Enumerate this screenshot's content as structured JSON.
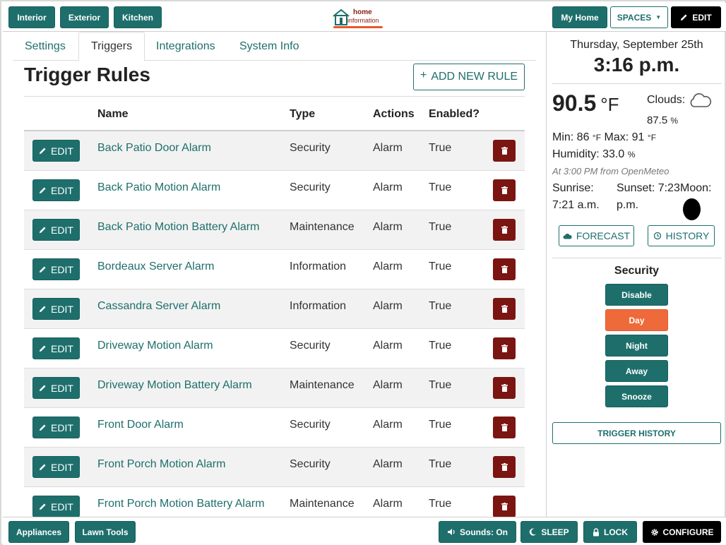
{
  "topbar": {
    "left_buttons": [
      "Interior",
      "Exterior",
      "Kitchen"
    ],
    "logo": {
      "line1": "home",
      "line2": "information"
    },
    "my_home": "My Home",
    "spaces": "SPACES",
    "edit": "EDIT"
  },
  "tabs": [
    "Settings",
    "Triggers",
    "Integrations",
    "System Info"
  ],
  "page": {
    "title": "Trigger Rules",
    "add_rule": "ADD NEW RULE"
  },
  "table": {
    "headers": {
      "name": "Name",
      "type": "Type",
      "actions": "Actions",
      "enabled": "Enabled?"
    },
    "edit_label": "EDIT",
    "rows": [
      {
        "name": "Back Patio Door Alarm",
        "type": "Security",
        "actions": "Alarm",
        "enabled": "True"
      },
      {
        "name": "Back Patio Motion Alarm",
        "type": "Security",
        "actions": "Alarm",
        "enabled": "True"
      },
      {
        "name": "Back Patio Motion Battery Alarm",
        "type": "Maintenance",
        "actions": "Alarm",
        "enabled": "True"
      },
      {
        "name": "Bordeaux Server Alarm",
        "type": "Information",
        "actions": "Alarm",
        "enabled": "True"
      },
      {
        "name": "Cassandra Server Alarm",
        "type": "Information",
        "actions": "Alarm",
        "enabled": "True"
      },
      {
        "name": "Driveway Motion Alarm",
        "type": "Security",
        "actions": "Alarm",
        "enabled": "True"
      },
      {
        "name": "Driveway Motion Battery Alarm",
        "type": "Maintenance",
        "actions": "Alarm",
        "enabled": "True"
      },
      {
        "name": "Front Door Alarm",
        "type": "Security",
        "actions": "Alarm",
        "enabled": "True"
      },
      {
        "name": "Front Porch Motion Alarm",
        "type": "Security",
        "actions": "Alarm",
        "enabled": "True"
      },
      {
        "name": "Front Porch Motion Battery Alarm",
        "type": "Maintenance",
        "actions": "Alarm",
        "enabled": "True"
      }
    ]
  },
  "side": {
    "date": "Thursday, September 25th",
    "time": "3:16 p.m.",
    "temperature": "90.5",
    "temp_unit": "°F",
    "clouds_label": "Clouds:",
    "clouds_value": "87.5",
    "clouds_unit": "%",
    "min_label": "Min: 86",
    "max_label": "Max: 91",
    "deg_unit": "°F",
    "humidity_label": "Humidity: 33.0",
    "humidity_unit": "%",
    "note": "At 3:00 PM from OpenMeteo",
    "sunrise_label": "Sunrise:",
    "sunrise_value": "7:21 a.m.",
    "sunset_label": "Sunset: 7:23",
    "sunset_value": "p.m.",
    "moon_label": "Moon:",
    "forecast": "FORECAST",
    "history": "HISTORY",
    "security_title": "Security",
    "security_modes": [
      "Disable",
      "Day",
      "Night",
      "Away",
      "Snooze"
    ],
    "security_active": "Day",
    "trigger_history": "TRIGGER HISTORY"
  },
  "bottombar": {
    "left_buttons": [
      "Appliances",
      "Lawn Tools"
    ],
    "sounds": "Sounds: On",
    "sleep": "SLEEP",
    "lock": "LOCK",
    "configure": "CONFIGURE"
  },
  "colors": {
    "teal": "#1e6f6c",
    "delete": "#7a1512",
    "active_mode": "#ef6a3a"
  }
}
